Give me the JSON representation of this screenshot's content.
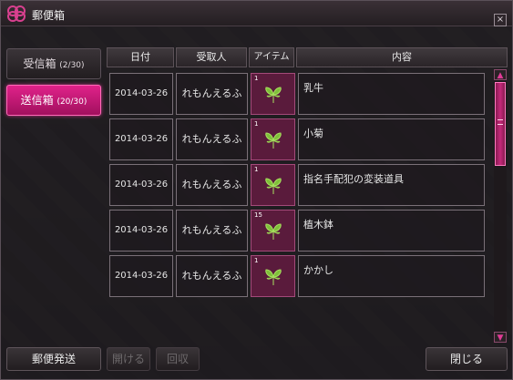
{
  "window": {
    "title": "郵便箱",
    "close_label": "×"
  },
  "tabs": {
    "inbox_label": "受信箱",
    "inbox_count": "(2/30)",
    "outbox_label": "送信箱",
    "outbox_count": "(20/30)"
  },
  "columns": {
    "date": "日付",
    "recipient": "受取人",
    "item": "アイテム",
    "content": "内容"
  },
  "rows": [
    {
      "date": "2014-03-26",
      "recipient": "れもんえるふ",
      "qty": "1",
      "content": "乳牛"
    },
    {
      "date": "2014-03-26",
      "recipient": "れもんえるふ",
      "qty": "1",
      "content": "小菊"
    },
    {
      "date": "2014-03-26",
      "recipient": "れもんえるふ",
      "qty": "1",
      "content": "指名手配犯の変装道具"
    },
    {
      "date": "2014-03-26",
      "recipient": "れもんえるふ",
      "qty": "15",
      "content": "植木鉢"
    },
    {
      "date": "2014-03-26",
      "recipient": "れもんえるふ",
      "qty": "1",
      "content": "かかし"
    }
  ],
  "buttons": {
    "send": "郵便発送",
    "open": "開ける",
    "recover": "回収",
    "close": "閉じる"
  },
  "colors": {
    "accent": "#e0228a",
    "item_bg": "#5a1b3c",
    "leaf": "#7fbf3a"
  },
  "icons": {
    "title": "mailbox-emblem-icon",
    "item": "leaf-item-icon"
  }
}
